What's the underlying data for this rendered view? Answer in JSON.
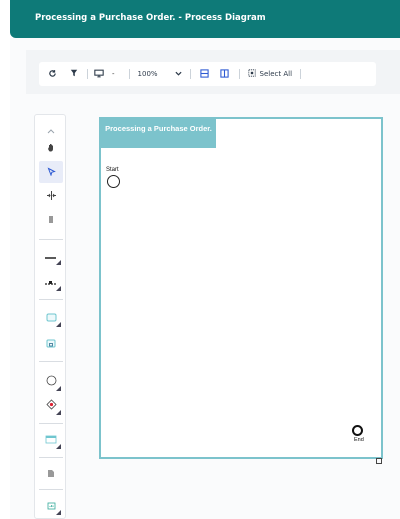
{
  "header": {
    "title": "Processing a Purchase Order. - Process Diagram"
  },
  "toolbar": {
    "items": [
      {
        "icon": "refresh-icon"
      },
      {
        "icon": "filter-icon"
      },
      {
        "icon": "monitor-icon"
      }
    ],
    "view_dash": "-",
    "zoom_value": "100%",
    "select_all_label": "Select All"
  },
  "palette": {
    "tools": [
      "chevron-up-icon",
      "hand-pan-icon",
      "pointer-select-icon",
      "split-horizontal-icon",
      "split-vertical-icon",
      "line-connector-icon",
      "dotted-connector-icon",
      "task-rectangle-icon",
      "subprocess-icon",
      "event-circle-icon",
      "gateway-diamond-icon",
      "pool-lane-icon",
      "document-icon",
      "data-store-icon"
    ]
  },
  "diagram": {
    "pool_title": "Processing a Purchase Order.",
    "start_label": "Start",
    "end_label": "End"
  },
  "colors": {
    "header": "#0e7a78",
    "pool": "#7cc3cc",
    "accent": "#2f5bd3"
  }
}
